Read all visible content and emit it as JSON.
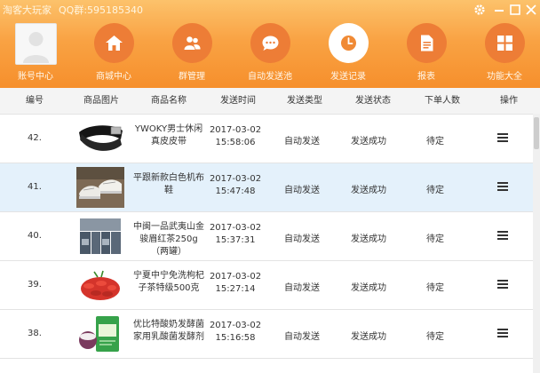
{
  "window": {
    "title": "淘客大玩家",
    "qq": "QQ群:595185340"
  },
  "nav": {
    "account": "账号中心",
    "items": [
      {
        "label": "商城中心",
        "icon": "home-icon"
      },
      {
        "label": "群管理",
        "icon": "group-icon"
      },
      {
        "label": "自动发送池",
        "icon": "chat-icon"
      },
      {
        "label": "发送记录",
        "icon": "clock-icon"
      },
      {
        "label": "报表",
        "icon": "document-icon"
      },
      {
        "label": "功能大全",
        "icon": "grid-icon"
      }
    ]
  },
  "table": {
    "headers": [
      "编号",
      "商品图片",
      "商品名称",
      "发送时间",
      "发送类型",
      "发送状态",
      "下单人数",
      "操作"
    ],
    "rows": [
      {
        "id": "42.",
        "name": "YWOKY男士休闲真皮皮带",
        "date": "2017-03-02",
        "time": "15:58:06",
        "type": "自动发送",
        "status": "发送成功",
        "order": "待定",
        "img": "belt"
      },
      {
        "id": "41.",
        "name": "平跟新款白色机布鞋",
        "date": "2017-03-02",
        "time": "15:47:48",
        "type": "自动发送",
        "status": "发送成功",
        "order": "待定",
        "img": "shoes"
      },
      {
        "id": "40.",
        "name": "中闽一品武夷山金骏眉红茶250g（两罐）",
        "date": "2017-03-02",
        "time": "15:37:31",
        "type": "自动发送",
        "status": "发送成功",
        "order": "待定",
        "img": "tea"
      },
      {
        "id": "39.",
        "name": "宁夏中宁免洗枸杞子茶特级500克",
        "date": "2017-03-02",
        "time": "15:27:14",
        "type": "自动发送",
        "status": "发送成功",
        "order": "待定",
        "img": "goji"
      },
      {
        "id": "38.",
        "name": "优比特酸奶发酵菌家用乳酸菌发酵剂",
        "date": "2017-03-02",
        "time": "15:16:58",
        "type": "自动发送",
        "status": "发送成功",
        "order": "待定",
        "img": "yogurt"
      }
    ],
    "selected_row_index": 1
  },
  "colors": {
    "header_top": "#fcc26b",
    "header_bottom": "#f68f2c",
    "nav_circle": "#ed7d36",
    "selected_row": "#e4f1fb"
  }
}
